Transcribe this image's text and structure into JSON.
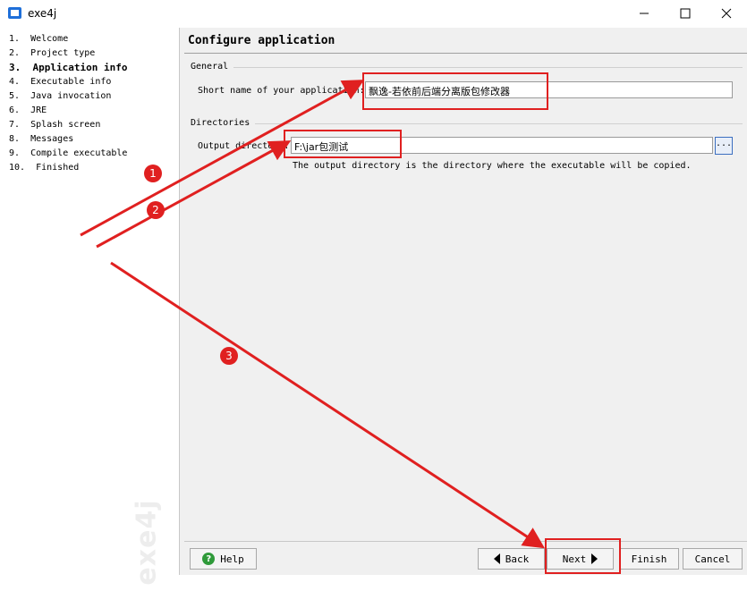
{
  "window": {
    "title": "exe4j",
    "minimize_icon": "minimize-icon",
    "maximize_icon": "maximize-icon",
    "close_icon": "close-icon"
  },
  "sidebar": {
    "steps": [
      {
        "label": "1.  Welcome",
        "active": false
      },
      {
        "label": "2.  Project type",
        "active": false
      },
      {
        "label": "3.  Application info",
        "active": true
      },
      {
        "label": "4.  Executable info",
        "active": false
      },
      {
        "label": "5.  Java invocation",
        "active": false
      },
      {
        "label": "6.  JRE",
        "active": false
      },
      {
        "label": "7.  Splash screen",
        "active": false
      },
      {
        "label": "8.  Messages",
        "active": false
      },
      {
        "label": "9.  Compile executable",
        "active": false
      },
      {
        "label": "10.  Finished",
        "active": false
      }
    ],
    "watermark": "exe4j"
  },
  "main": {
    "title": "Configure application",
    "general": {
      "group_label": "General",
      "short_name_label": "Short name of your application:",
      "short_name_value": "飘逸-若依前后端分离版包修改器"
    },
    "directories": {
      "group_label": "Directories",
      "output_label": "Output directory:",
      "output_value": "F:\\jar包测试",
      "browse_label": "...",
      "hint": "The output directory is the directory where the executable will be copied."
    }
  },
  "buttons": {
    "help": "Help",
    "back": "Back",
    "next": "Next",
    "finish": "Finish",
    "cancel": "Cancel"
  },
  "annotations": {
    "badges": [
      "1",
      "2",
      "3"
    ],
    "color": "#e02020"
  }
}
